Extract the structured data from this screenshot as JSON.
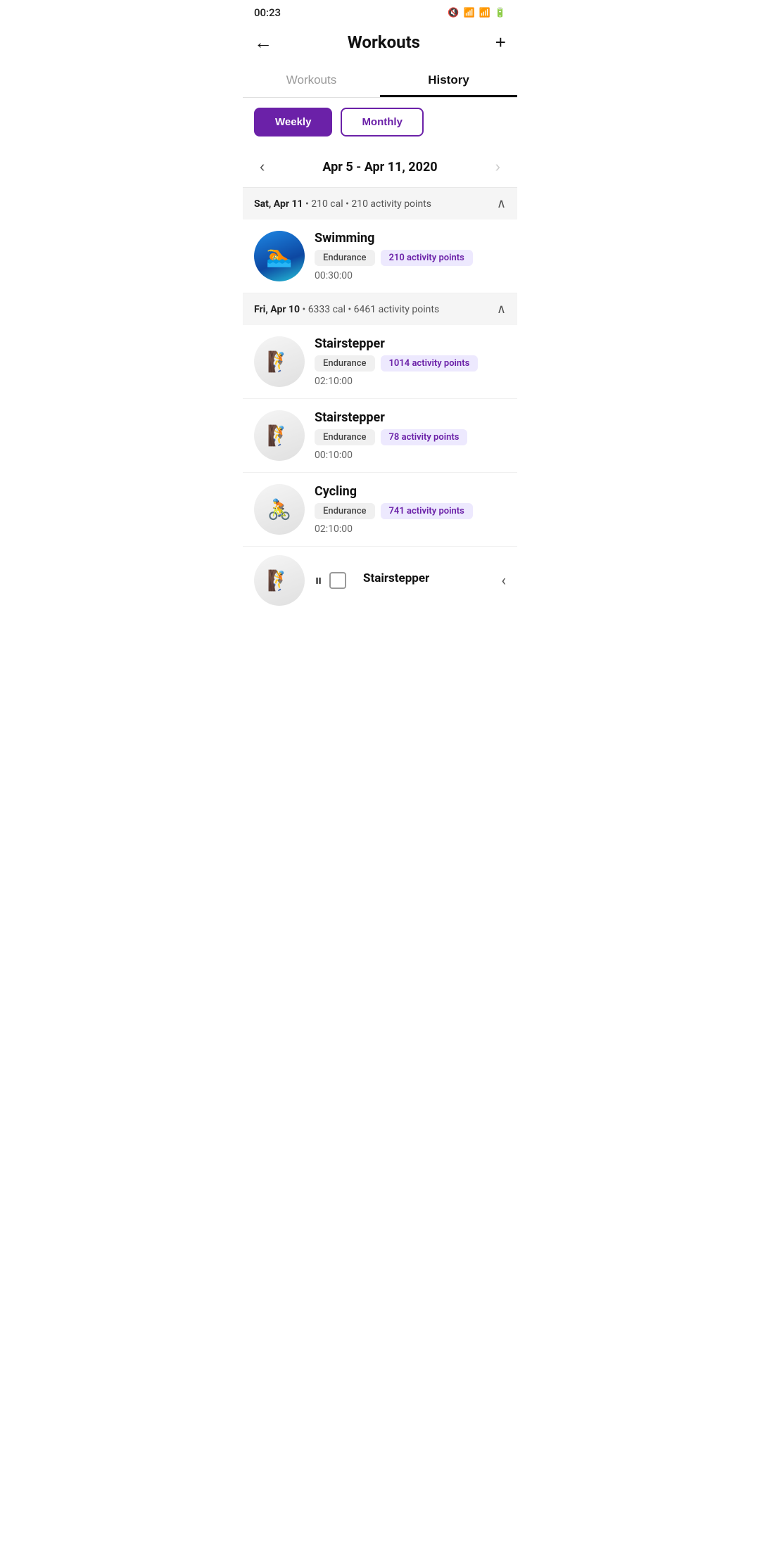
{
  "statusBar": {
    "time": "00:23",
    "icons": [
      "ⓘ",
      "📋",
      "🔇",
      "📶",
      "📶",
      "🔋"
    ]
  },
  "header": {
    "backLabel": "←",
    "title": "Workouts",
    "addLabel": "+"
  },
  "tabs": [
    {
      "id": "workouts",
      "label": "Workouts",
      "active": false
    },
    {
      "id": "history",
      "label": "History",
      "active": true
    }
  ],
  "filters": [
    {
      "id": "weekly",
      "label": "Weekly",
      "active": true
    },
    {
      "id": "monthly",
      "label": "Monthly",
      "active": false
    }
  ],
  "dateNav": {
    "prevLabel": "‹",
    "nextLabel": "›",
    "dateRange": "Apr 5 - Apr 11, 2020",
    "nextDisabled": true
  },
  "daySections": [
    {
      "id": "sat-apr-11",
      "dayName": "Sat, Apr 11",
      "calories": "210 cal",
      "activityPoints": "210 activity points",
      "expanded": true,
      "workouts": [
        {
          "id": "swimming-1",
          "name": "Swimming",
          "avatarType": "swimming",
          "category": "Endurance",
          "activityPoints": "210 activity points",
          "duration": "00:30:00"
        }
      ]
    },
    {
      "id": "fri-apr-10",
      "dayName": "Fri, Apr 10",
      "calories": "6333 cal",
      "activityPoints": "6461 activity points",
      "expanded": true,
      "workouts": [
        {
          "id": "stairstepper-1",
          "name": "Stairstepper",
          "avatarType": "stairstepper",
          "category": "Endurance",
          "activityPoints": "1014 activity points",
          "duration": "02:10:00"
        },
        {
          "id": "stairstepper-2",
          "name": "Stairstepper",
          "avatarType": "stairstepper",
          "category": "Endurance",
          "activityPoints": "78 activity points",
          "duration": "00:10:00"
        },
        {
          "id": "cycling-1",
          "name": "Cycling",
          "avatarType": "cycling",
          "category": "Endurance",
          "activityPoints": "741 activity points",
          "duration": "02:10:00"
        }
      ]
    }
  ],
  "partialItem": {
    "name": "Stairstepper",
    "avatarType": "stairstepper"
  }
}
